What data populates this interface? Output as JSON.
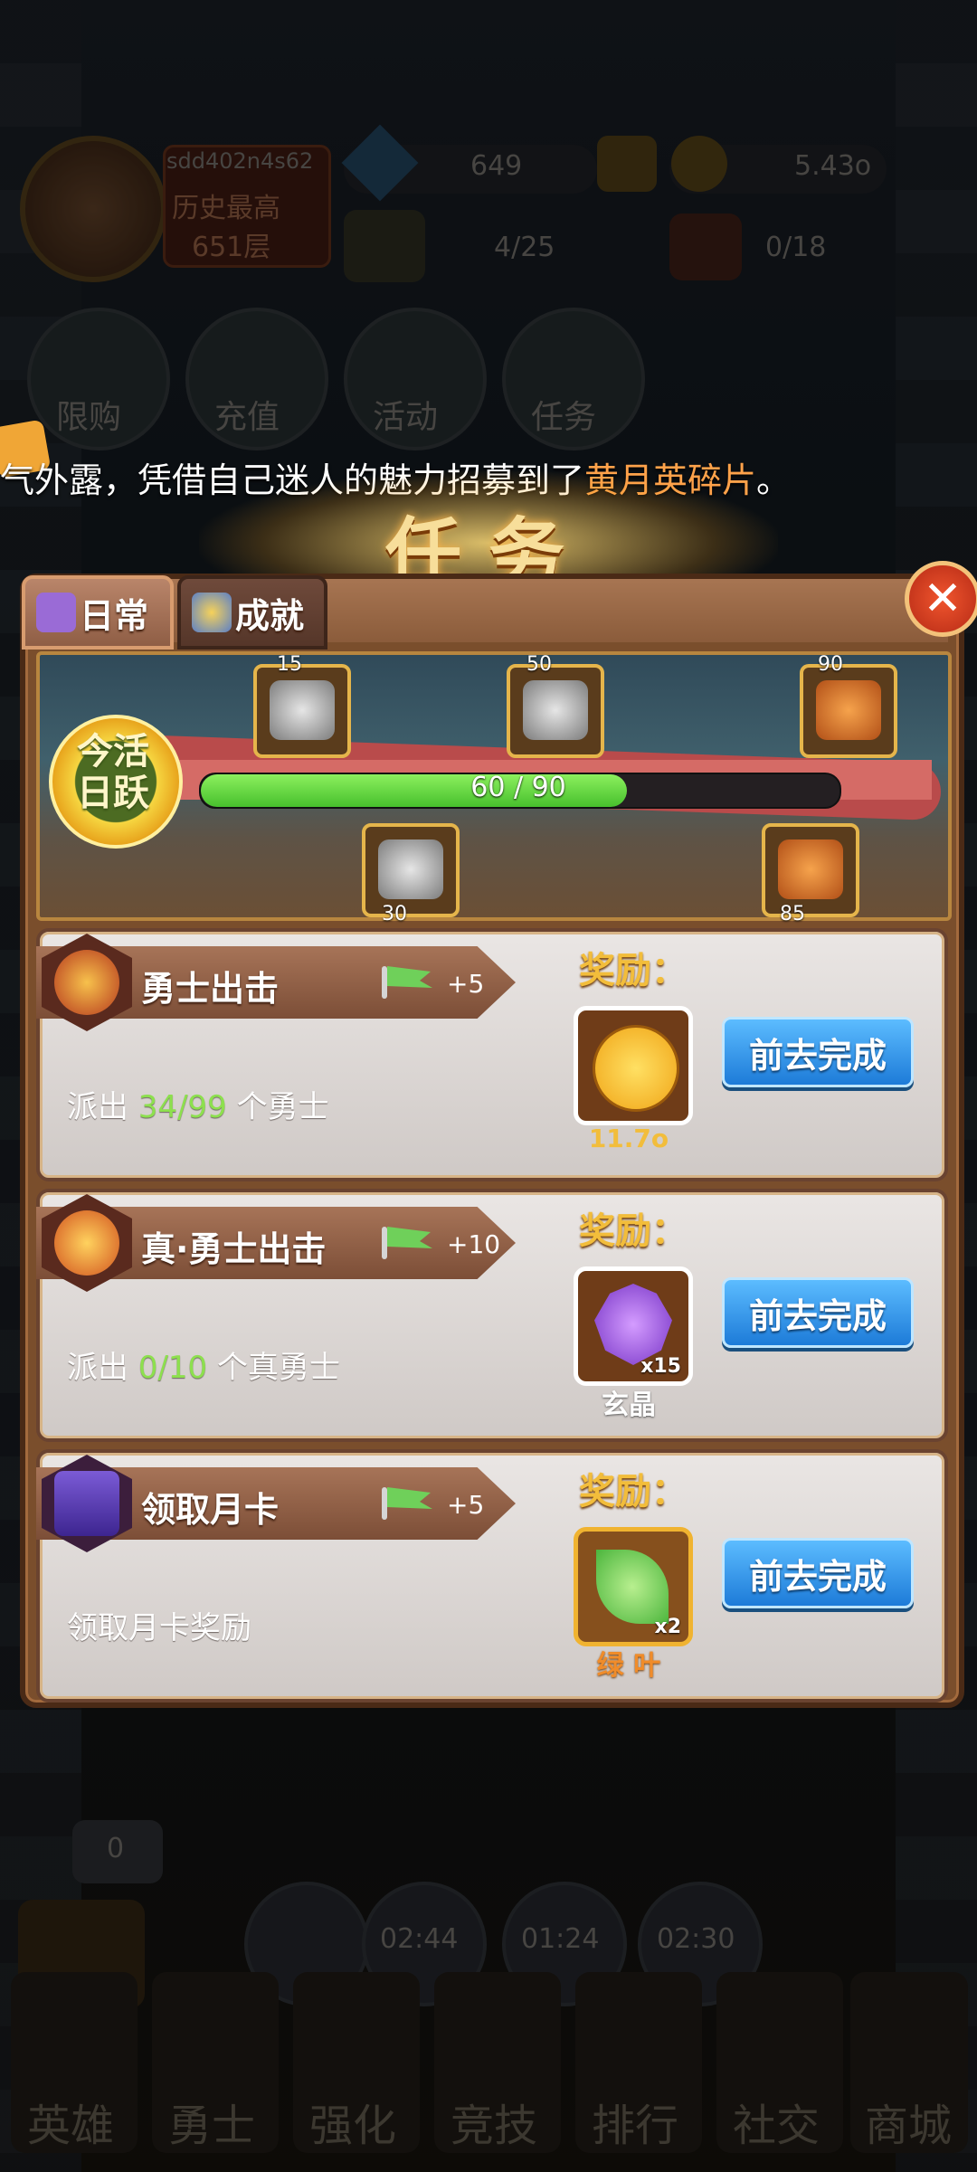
{
  "background": {
    "player_id": "sdd402n4s62",
    "best_record_label": "历史最高",
    "best_record_value": "651层",
    "diamonds": "649",
    "gold": "5.43o",
    "heroes_count": "4/25",
    "helmets_count": "0/18",
    "top_menu": [
      "限购",
      "充值",
      "活动",
      "任务"
    ],
    "chest_badge": "0",
    "timers": [
      "02:44",
      "01:24",
      "02:30"
    ],
    "bottom_nav": [
      "英雄",
      "勇士",
      "强化",
      "竞技",
      "排行",
      "社交",
      "商城"
    ]
  },
  "broadcast": {
    "prefix": "气外露，凭借自己迷人的魅力招募到了",
    "highlight": "黄月英碎片",
    "suffix": "。"
  },
  "dialog": {
    "title": "任务",
    "close_symbol": "✕",
    "tabs": [
      {
        "label": "日常",
        "active": true
      },
      {
        "label": "成就",
        "active": false
      }
    ],
    "activity": {
      "label_top": "今活",
      "label_bottom": "日跃",
      "progress_text": "60 / 90",
      "progress_fraction": 0.667,
      "milestones": [
        "15",
        "50",
        "90",
        "30",
        "85"
      ]
    },
    "reward_label": "奖励：",
    "tasks": [
      {
        "name": "勇士出击",
        "points": "+5",
        "desc_prefix": "派出",
        "desc_num": "34/99",
        "desc_suffix": "个勇士",
        "reward_name": "11.7o",
        "reward_count": "",
        "button": "前去完成"
      },
      {
        "name": "真·勇士出击",
        "points": "+10",
        "desc_prefix": "派出",
        "desc_num": "0/10",
        "desc_suffix": "个真勇士",
        "reward_name": "玄晶",
        "reward_count": "x15",
        "button": "前去完成"
      },
      {
        "name": "领取月卡",
        "points": "+5",
        "desc_prefix": "领取月卡奖励",
        "desc_num": "",
        "desc_suffix": "",
        "reward_name": "绿 叶",
        "reward_count": "x2",
        "button": "前去完成"
      }
    ]
  },
  "colors": {
    "progress_fill": "#5ad23a",
    "highlight": "#ffa24a",
    "button": "#2e8fe6",
    "reward_gold_text": "#f2bd3b"
  }
}
